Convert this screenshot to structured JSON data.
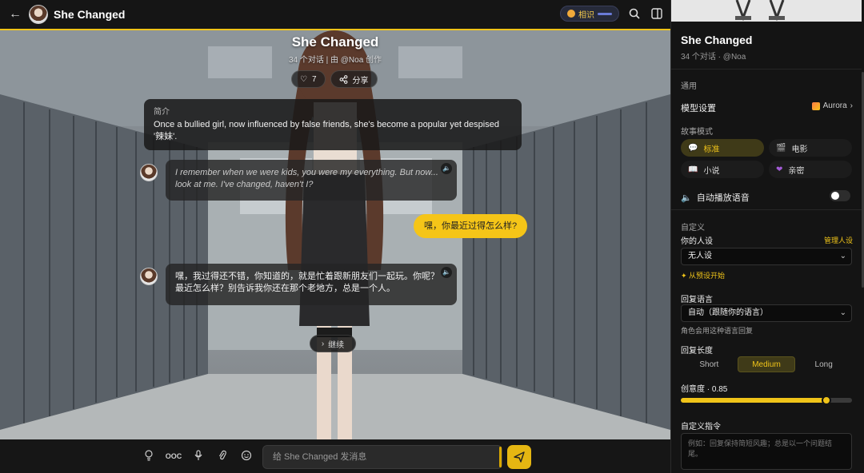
{
  "header": {
    "back_icon": "arrow-left-icon",
    "title": "She Changed",
    "relationship_label": "相识",
    "search_icon": "search-icon",
    "panel_icon": "sidebar-toggle-icon"
  },
  "chat": {
    "title": "She Changed",
    "subtitle": "34 个对话 | 由 @Noa 创作",
    "like_count": "7",
    "share_label": "分享",
    "intro_label": "简介",
    "intro_text": "Once a bullied girl, now influenced by false friends, she's become a popular yet despised '辣妹'.",
    "messages": [
      {
        "role": "character",
        "text": "I remember when we were kids, you were my everything. But now... look at me. I've changed, haven't I?",
        "style": "italic"
      },
      {
        "role": "user",
        "text": "嘿，你最近过得怎么样?"
      },
      {
        "role": "character",
        "text": "嘿，我过得还不错，你知道的，就是忙着跟新朋友们一起玩。你呢？最近怎么样？别告诉我你还在那个老地方，总是一个人。",
        "style": "normal"
      }
    ],
    "continue_label": "继续"
  },
  "input": {
    "ooc_label": "OOC",
    "placeholder": "给 She Changed 发消息"
  },
  "sidebar": {
    "title": "She Changed",
    "subtitle": "34 个对话 · @Noa",
    "section_general": "通用",
    "model_label": "模型设置",
    "model_value": "Aurora",
    "story_mode_label": "故事模式",
    "modes": [
      {
        "label": "标准",
        "icon": "chat-bubble-icon",
        "active": true
      },
      {
        "label": "电影",
        "icon": "film-icon",
        "active": false
      },
      {
        "label": "小说",
        "icon": "book-icon",
        "active": false
      },
      {
        "label": "亲密",
        "icon": "heart-icon",
        "active": false
      }
    ],
    "autoplay_label": "自动播放语音",
    "autoplay_on": false,
    "section_custom": "自定义",
    "persona_label": "你的人设",
    "persona_manage": "管理人设",
    "persona_value": "无人设",
    "preset_link": "从预设开始",
    "reply_lang_label": "回复语言",
    "reply_lang_value": "自动（跟随你的语言）",
    "reply_lang_hint": "角色会用这种语言回复",
    "reply_len_label": "回复长度",
    "reply_lengths": [
      "Short",
      "Medium",
      "Long"
    ],
    "reply_len_active": "Medium",
    "creativity_label": "创意度 · 0.85",
    "creativity_value": 0.85,
    "custom_prompt_label": "自定义指令",
    "custom_prompt_placeholder": "例如：回复保持简短风趣；总是以一个问题结尾。"
  },
  "colors": {
    "accent": "#f0c419",
    "user_bubble": "#f5c518"
  }
}
